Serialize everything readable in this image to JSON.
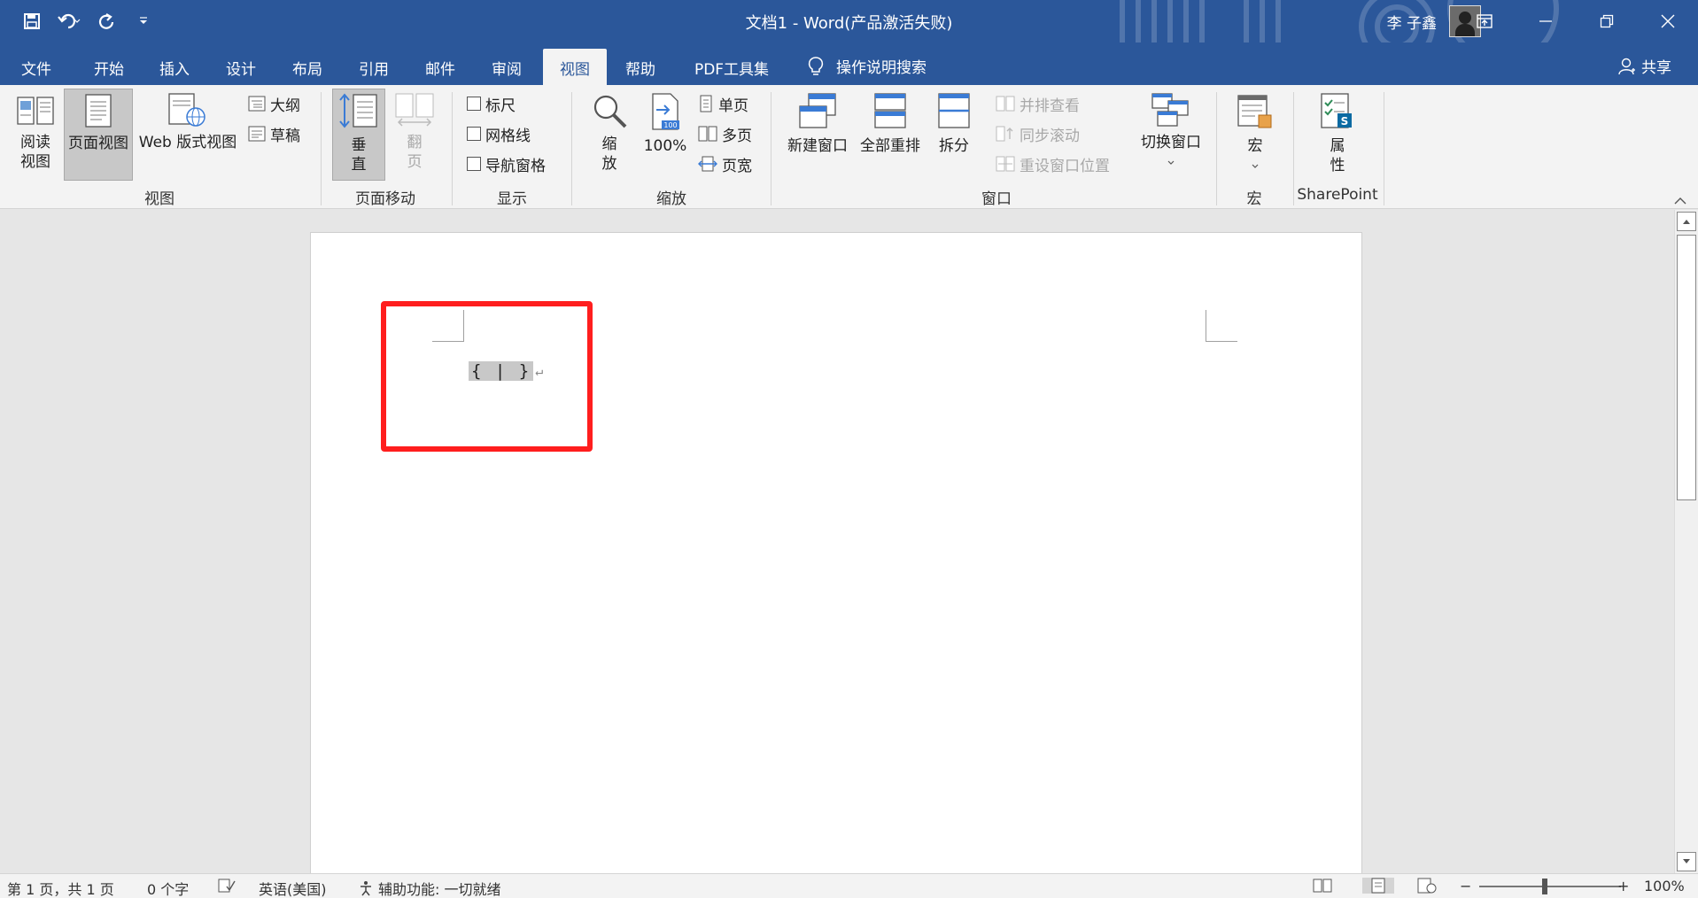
{
  "window": {
    "title": "文档1  -  Word(产品激活失败)",
    "user_name": "李 子鑫"
  },
  "colors": {
    "brand": "#2b579a",
    "annotation": "#ff1e1e",
    "ribbon_bg": "#f3f3f3"
  },
  "tabs": [
    {
      "label": "文件"
    },
    {
      "label": "开始"
    },
    {
      "label": "插入"
    },
    {
      "label": "设计"
    },
    {
      "label": "布局"
    },
    {
      "label": "引用"
    },
    {
      "label": "邮件"
    },
    {
      "label": "审阅"
    },
    {
      "label": "视图",
      "active": true
    },
    {
      "label": "帮助"
    },
    {
      "label": "PDF工具集"
    }
  ],
  "tell_me": "操作说明搜索",
  "share": "共享",
  "ribbon": {
    "views": {
      "read_mode_1": "阅读",
      "read_mode_2": "视图",
      "print_layout": "页面视图",
      "web_layout": "Web 版式视图",
      "outline": "大纲",
      "draft": "草稿",
      "group": "视图"
    },
    "page_movement": {
      "vertical_1": "垂",
      "vertical_2": "直",
      "side_1": "翻",
      "side_2": "页",
      "group": "页面移动"
    },
    "show": {
      "ruler": "标尺",
      "gridlines": "网格线",
      "nav_pane": "导航窗格",
      "group": "显示"
    },
    "zoom": {
      "zoom_1": "缩",
      "zoom_2": "放",
      "percent": "100%",
      "icon_badge": "100",
      "one_page": "单页",
      "multi_page": "多页",
      "page_width": "页宽",
      "group": "缩放"
    },
    "window": {
      "new_window": "新建窗口",
      "arrange_all": "全部重排",
      "split": "拆分",
      "side_by_side": "并排查看",
      "sync_scroll": "同步滚动",
      "reset_pos": "重设窗口位置",
      "switch_windows": "切换窗口",
      "group": "窗口"
    },
    "macros": {
      "label": "宏",
      "group": "宏"
    },
    "sharepoint": {
      "prop_1": "属",
      "prop_2": "性",
      "badge": "S",
      "group": "SharePoint"
    }
  },
  "document": {
    "field_code": "{ | }",
    "para_mark": "↵"
  },
  "status": {
    "page": "第 1 页，共 1 页",
    "words": "0 个字",
    "language": "英语(美国)",
    "accessibility": "辅助功能: 一切就绪",
    "zoom_minus": "−",
    "zoom_plus": "+",
    "zoom": "100%"
  }
}
